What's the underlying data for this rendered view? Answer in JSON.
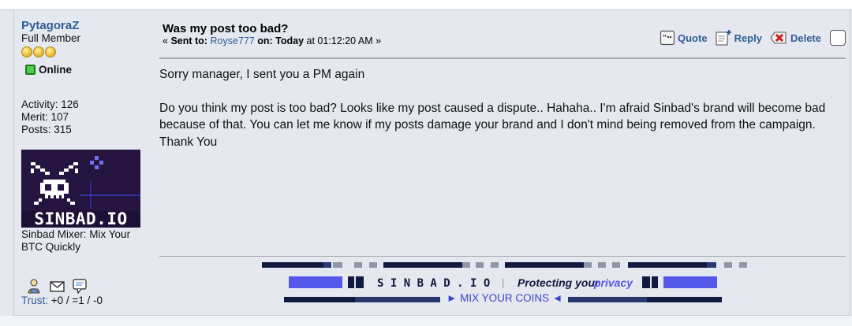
{
  "poster": {
    "name": "PytagoraZ",
    "rank": "Full Member",
    "stars": 3,
    "status": "Online",
    "activity": "Activity: 126",
    "merit": "Merit: 107",
    "posts": "Posts: 315",
    "avatar_text": "SINBAD.IO",
    "personal_text": "Sinbad Mixer: Mix Your BTC Quickly",
    "trust_label": "Trust:",
    "trust_value": " +0 / =1 / -0"
  },
  "post": {
    "subject": "Was my post too bad?",
    "sent_prefix": "« ",
    "sent_to_label": "Sent to:",
    "sent_to_user": "Royse777",
    "on_label": "on:",
    "date": "Today",
    "time": "at 01:12:20 AM »",
    "paragraphs": [
      "Sorry manager, I sent you a PM again",
      "Do you think my post is too bad? Looks like my post caused a dispute.. Hahaha.. I'm afraid Sinbad's brand will become bad because of that. You can let me know if my posts damage your brand and I don't mind being removed from the campaign. Thank You"
    ]
  },
  "actions": {
    "quote": "Quote",
    "reply": "Reply",
    "delete": "Delete"
  },
  "signature": {
    "brand": "S I N B A D . I O",
    "separator": "|",
    "tagline_prefix": "Protecting your",
    "tagline_highlight": "privacy",
    "sub_line": "► MIX YOUR COINS ◄"
  },
  "colors": {
    "link": "#2f5e96",
    "sig_dark": "#101a3e",
    "sig_blue": "#5558e8",
    "sig_gray": "#8f96a8"
  }
}
